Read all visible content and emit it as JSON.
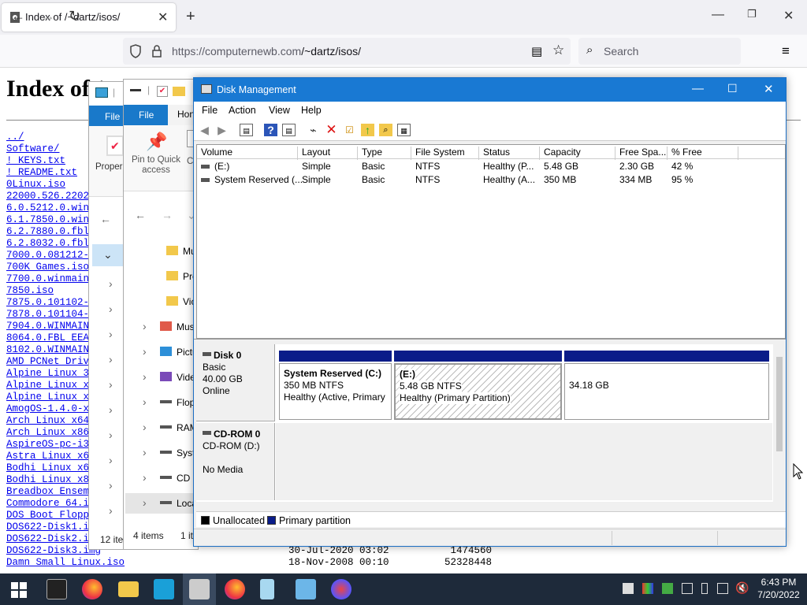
{
  "browser": {
    "tab_title": "Index of /~dartz/isos/",
    "url_host": "https://computernewb.com",
    "url_path": "/~dartz/isos/",
    "search_placeholder": "Search"
  },
  "page": {
    "heading": "Index of /",
    "files": [
      "../",
      "Software/",
      "! KEYS.txt",
      "! README.txt",
      "0Linux.iso",
      "22000.526.22020",
      "6.0.5212.0.winm",
      "6.1.7850.0.winm",
      "6.2.7880.0.fbl_",
      "6.2.8032.0.fbl_",
      "7000.0.081212-1",
      "700K Games.iso",
      "7700.0.winmain.",
      "7850.iso",
      "7875.0.101102-1",
      "7878.0.101104-1",
      "7904.0.WINMAIN.",
      "8064.0.FBL_EEAP",
      "8102.0.WINMAIN_",
      "AMD PCNet Drive",
      "Alpine Linux 3.",
      "Alpine Linux x6",
      "Alpine Linux x8",
      "AmogOS-1.4.0-x8",
      "Arch Linux x64.",
      "Arch Linux x86.",
      "AspireOS-pc-i38",
      "Astra Linux x64",
      "Bodhi Linux x64",
      "Bodhi Linux x86",
      "Breadbox Ensemb",
      "Commodore_64.is",
      "DOS Boot Floppy",
      "DOS622-Disk1.im",
      "DOS622-Disk2.im"
    ],
    "bottom_rows": [
      {
        "name": "DOS622-Disk3.img",
        "date": "30-Jul-2020 03:02",
        "size": "1474560"
      },
      {
        "name": "Damn Small Linux.iso",
        "date": "18-Nov-2008 00:10",
        "size": "52328448"
      }
    ]
  },
  "explorer1": {
    "file_tab": "File",
    "ribbon_item": "Proper",
    "status": "12 ite"
  },
  "explorer2": {
    "file_tab": "File",
    "home_tab": "Hon",
    "pin_label": "Pin to Quick access",
    "ribbon_col2": "Co",
    "nav_items": [
      "Mu",
      "Pro",
      "Vic",
      "Mus",
      "Pictu",
      "Vide",
      "Flop",
      "RAM",
      "Syst",
      "CD D",
      "Loca"
    ],
    "status_items": "4 items",
    "status_sel": "1 it"
  },
  "disk_mgmt": {
    "title": "Disk Management",
    "menu": [
      "File",
      "Action",
      "View",
      "Help"
    ],
    "columns": [
      "Volume",
      "Layout",
      "Type",
      "File System",
      "Status",
      "Capacity",
      "Free Spa...",
      "% Free"
    ],
    "volumes": [
      {
        "volume": "(E:)",
        "layout": "Simple",
        "type": "Basic",
        "fs": "NTFS",
        "status": "Healthy (P...",
        "capacity": "5.48 GB",
        "free": "2.30 GB",
        "pct": "42 %"
      },
      {
        "volume": "System Reserved (...",
        "layout": "Simple",
        "type": "Basic",
        "fs": "NTFS",
        "status": "Healthy (A...",
        "capacity": "350 MB",
        "free": "334 MB",
        "pct": "95 %"
      }
    ],
    "disk0": {
      "name": "Disk 0",
      "type": "Basic",
      "size": "40.00 GB",
      "state": "Online",
      "partitions": [
        {
          "name": "System Reserved  (C:)",
          "size": "350 MB NTFS",
          "status": "Healthy (Active, Primary"
        },
        {
          "name": "(E:)",
          "size": "5.48 GB NTFS",
          "status": "Healthy (Primary Partition)"
        },
        {
          "name": "",
          "size": "34.18 GB",
          "status": ""
        }
      ]
    },
    "cdrom0": {
      "name": "CD-ROM 0",
      "drive": "CD-ROM (D:)",
      "media": "No Media"
    },
    "legend": {
      "unallocated": "Unallocated",
      "primary": "Primary partition",
      "unallocated_color": "#000000",
      "primary_color": "#0a1c89"
    }
  },
  "taskbar": {
    "time": "6:43 PM",
    "date": "7/20/2022"
  }
}
